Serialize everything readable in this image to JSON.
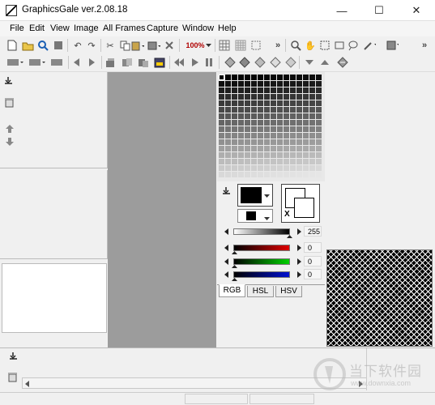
{
  "app": {
    "title": "GraphicsGale ver.2.08.18"
  },
  "window_controls": {
    "minimize": "—",
    "maximize": "☐",
    "close": "✕"
  },
  "menu": [
    "File",
    "Edit",
    "View",
    "Image",
    "All Frames",
    "Capture",
    "Window",
    "Help"
  ],
  "toolbar": {
    "zoom_label": "100%",
    "overflow": "»"
  },
  "color_panel": {
    "swap_label": "X",
    "gray_value": "255",
    "red_value": "0",
    "green_value": "0",
    "blue_value": "0",
    "tabs": [
      "RGB",
      "HSL",
      "HSV"
    ],
    "active_tab": "RGB"
  },
  "colors": {
    "canvas_bg": "#9c9c9c",
    "preview_checker_a": "#000000",
    "preview_checker_b": "#ffffff",
    "red_track": "#e00000",
    "green_track": "#00d000",
    "blue_track": "#0010d0"
  },
  "watermark": {
    "text": "当下软件园",
    "url": "www.downxia.com"
  }
}
